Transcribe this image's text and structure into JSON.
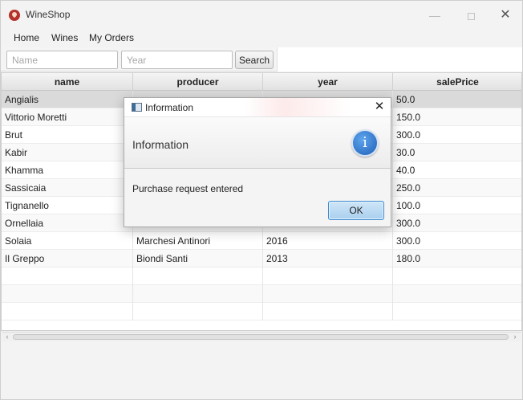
{
  "window": {
    "title": "WineShop",
    "controls": {
      "minimize": "—",
      "close": "✕"
    }
  },
  "menu": {
    "items": [
      "Home",
      "Wines",
      "My Orders"
    ]
  },
  "toolbar": {
    "name_placeholder": "Name",
    "year_placeholder": "Year",
    "search_label": "Search"
  },
  "table": {
    "columns": [
      "name",
      "producer",
      "year",
      "salePrice"
    ],
    "rows": [
      {
        "name": "Angialis",
        "producer": "",
        "year": "",
        "salePrice": "50.0"
      },
      {
        "name": "Vittorio Moretti",
        "producer": "",
        "year": "",
        "salePrice": "150.0"
      },
      {
        "name": "Brut",
        "producer": "",
        "year": "",
        "salePrice": "300.0"
      },
      {
        "name": "Kabir",
        "producer": "",
        "year": "",
        "salePrice": "30.0"
      },
      {
        "name": "Khamma",
        "producer": "",
        "year": "",
        "salePrice": "40.0"
      },
      {
        "name": "Sassicaia",
        "producer": "",
        "year": "",
        "salePrice": "250.0"
      },
      {
        "name": "Tignanello",
        "producer": "",
        "year": "",
        "salePrice": "100.0"
      },
      {
        "name": "Ornellaia",
        "producer": "",
        "year": "",
        "salePrice": "300.0"
      },
      {
        "name": "Solaia",
        "producer": "Marchesi Antinori",
        "year": "2016",
        "salePrice": "300.0"
      },
      {
        "name": "Il Greppo",
        "producer": "Biondi Santi",
        "year": "2013",
        "salePrice": "180.0"
      }
    ],
    "selected_row": "Angialis",
    "empty_rows": 3,
    "scroll_left": "‹",
    "scroll_right": "›"
  },
  "dialog": {
    "title": "Information",
    "header": "Information",
    "icon": "info-icon",
    "icon_glyph": "i",
    "content": "Purchase request entered",
    "ok_label": "OK",
    "close_glyph": "✕"
  },
  "colors": {
    "selected_row": "#dadada",
    "ok_button_border": "#3c8ad0",
    "info_icon": "#1f5fb6",
    "app_icon": "#b4312c"
  }
}
